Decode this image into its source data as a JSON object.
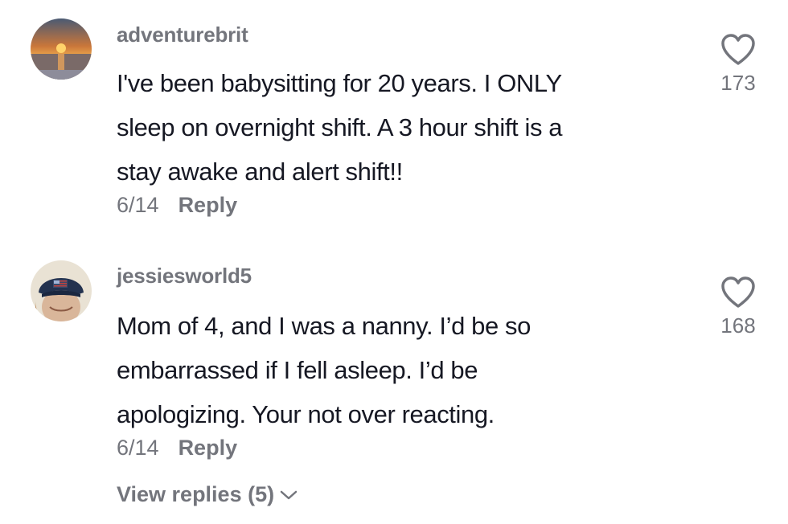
{
  "comments": [
    {
      "username": "adventurebrit",
      "avatar_icon": "sunset-beach-avatar",
      "lines": [
        "I've been babysitting for 20 years. I ONLY",
        "sleep on overnight shift. A 3 hour shift is a",
        "stay awake and alert shift!!"
      ],
      "date": "6/14",
      "reply_label": "Reply",
      "like_icon": "heart-outline-icon",
      "likes": "173"
    },
    {
      "username": "jessiesworld5",
      "avatar_icon": "person-in-cap-avatar",
      "lines": [
        "Mom of 4, and I was a nanny. I’d be so",
        "embarrassed if I fell asleep. I’d be",
        "apologizing. Your not over reacting."
      ],
      "date": "6/14",
      "reply_label": "Reply",
      "like_icon": "heart-outline-icon",
      "likes": "168"
    }
  ],
  "view_replies": {
    "label": "View replies (5)",
    "icon": "chevron-down-icon"
  },
  "colors": {
    "primary_text": "#161823",
    "secondary_text": "#73757c",
    "background": "#ffffff"
  }
}
